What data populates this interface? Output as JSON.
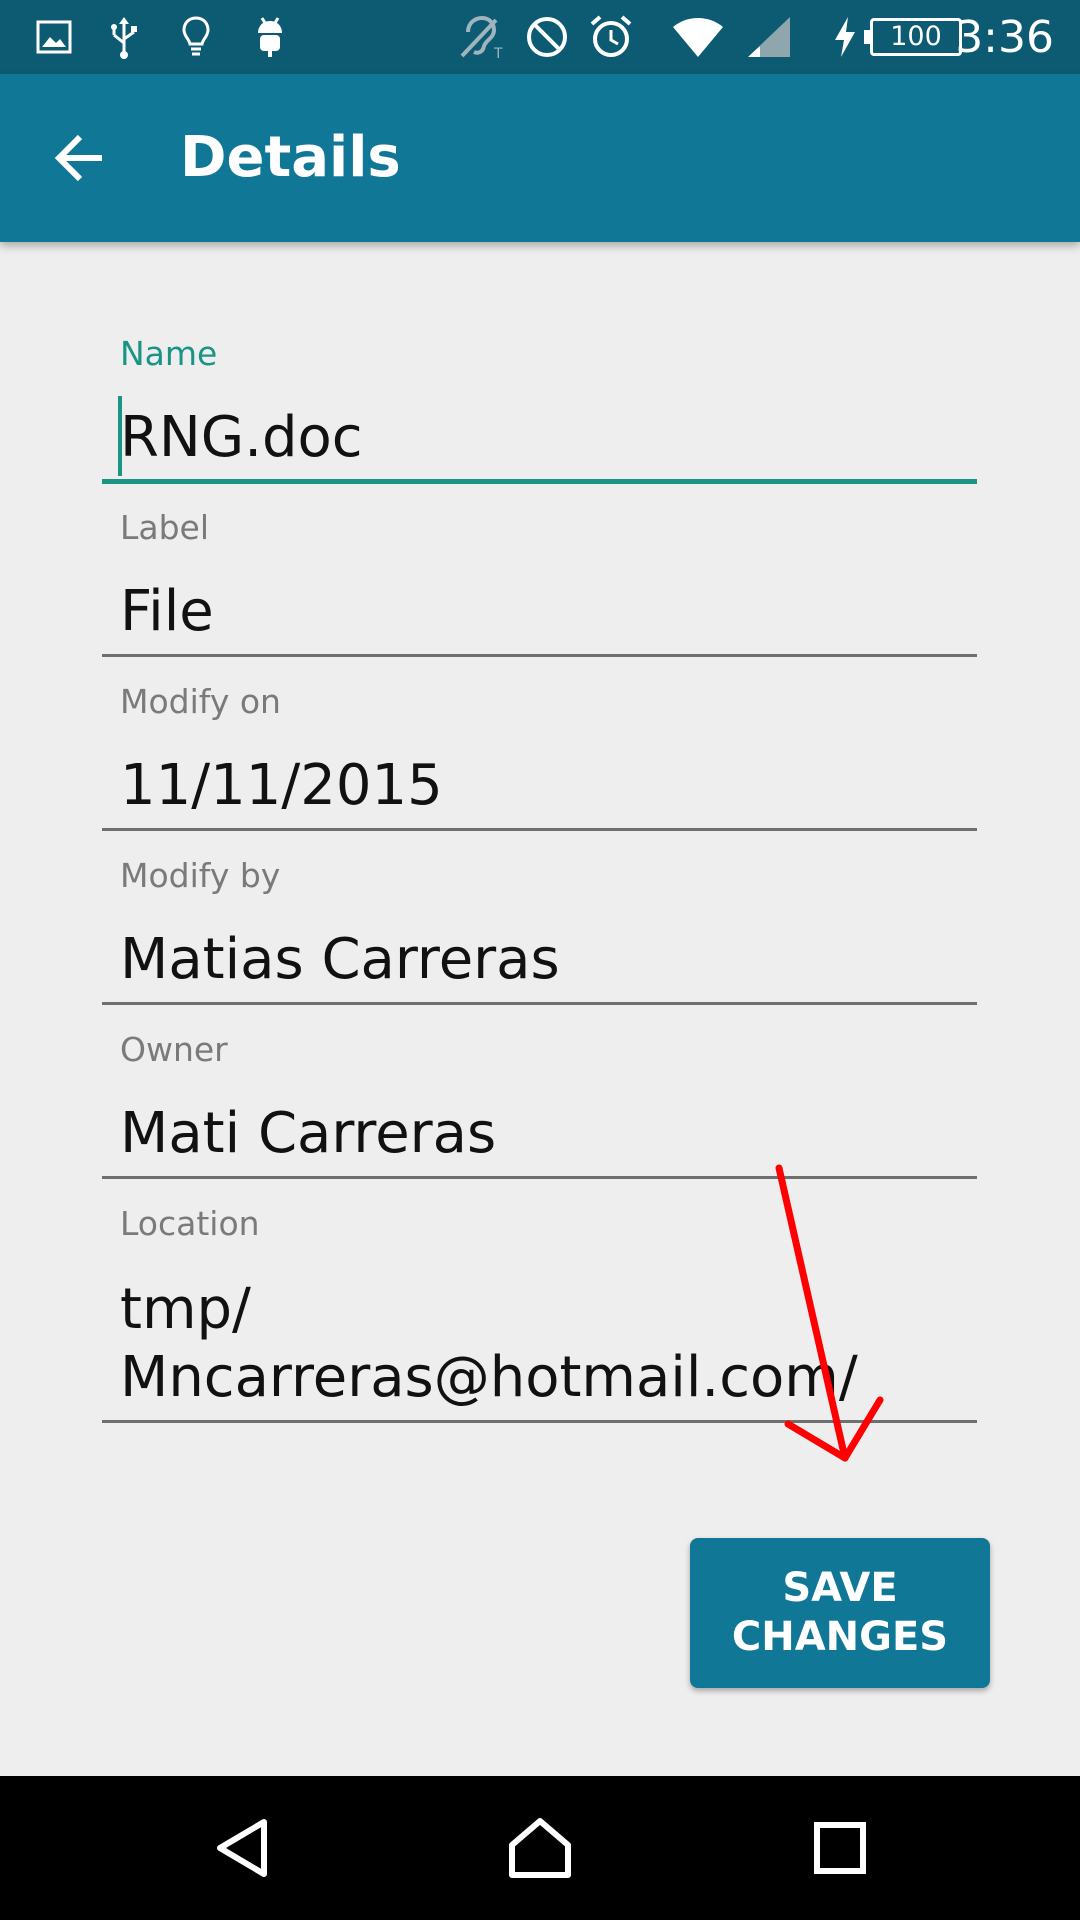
{
  "status_bar": {
    "time": "3:36",
    "battery_level": "100",
    "icons": [
      "image-icon",
      "usb-icon",
      "lightbulb-icon",
      "android-debug-icon",
      "hearing-aid-tty-icon",
      "do-not-disturb-icon",
      "alarm-icon",
      "wifi-icon",
      "cell-signal-icon",
      "charging-bolt-icon"
    ]
  },
  "app_bar": {
    "title": "Details",
    "back_icon": "arrow-back-icon"
  },
  "form": {
    "name": {
      "label": "Name",
      "value": "RNG.doc"
    },
    "label": {
      "label": "Label",
      "value": "File"
    },
    "modify_on": {
      "label": "Modify on",
      "value": "11/11/2015"
    },
    "modify_by": {
      "label": "Modify by",
      "value": "Matias Carreras"
    },
    "owner": {
      "label": "Owner",
      "value": "Mati Carreras"
    },
    "location": {
      "label": "Location",
      "value": "tmp/\nMncarreras@hotmail.com/"
    }
  },
  "actions": {
    "save_label": "SAVE\nCHANGES"
  },
  "nav_bar": {
    "icons": [
      "back-triangle-icon",
      "home-icon",
      "recents-icon"
    ]
  },
  "colors": {
    "status_bar": "#0D5B73",
    "app_bar": "#107896",
    "accent": "#1A9485",
    "background": "#EEEEEE",
    "annotation": "#FF0000"
  }
}
